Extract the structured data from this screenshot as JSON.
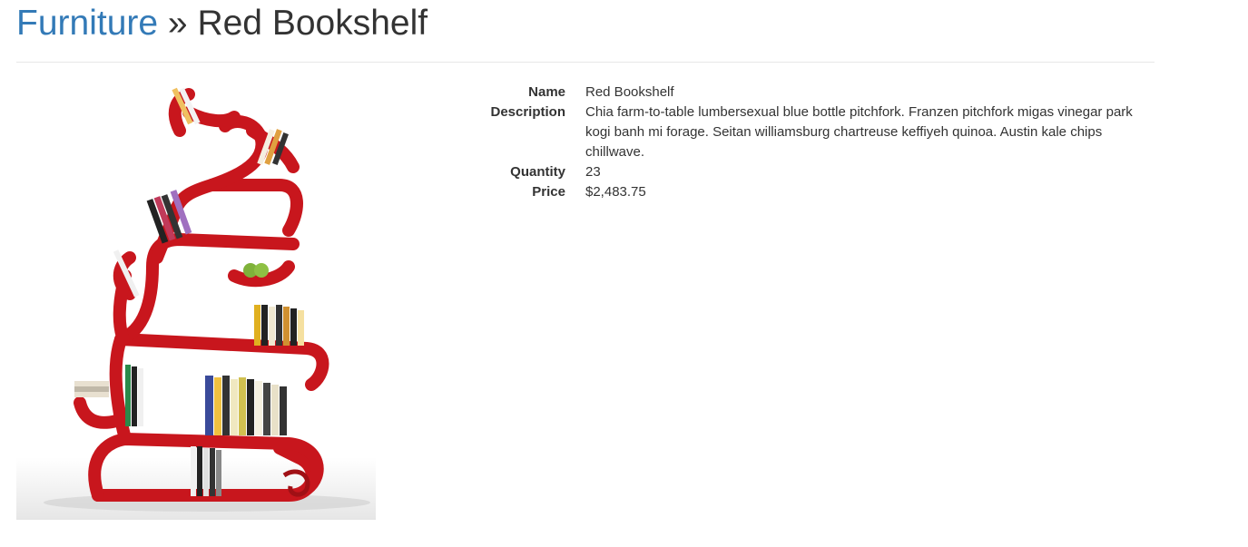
{
  "breadcrumb": {
    "category": "Furniture",
    "separator": "»",
    "item": "Red Bookshelf"
  },
  "product": {
    "image_alt": "Red Bookshelf",
    "fields": [
      {
        "label": "Name",
        "value": "Red Bookshelf"
      },
      {
        "label": "Description",
        "value": "Chia farm-to-table lumbersexual blue bottle pitchfork. Franzen pitchfork migas vinegar park kogi banh mi forage. Seitan williamsburg chartreuse keffiyeh quinoa. Austin kale chips chillwave."
      },
      {
        "label": "Quantity",
        "value": "23"
      },
      {
        "label": "Price",
        "value": "$2,483.75"
      }
    ]
  },
  "colors": {
    "link": "#337ab7",
    "shelf_red": "#c8161d"
  }
}
